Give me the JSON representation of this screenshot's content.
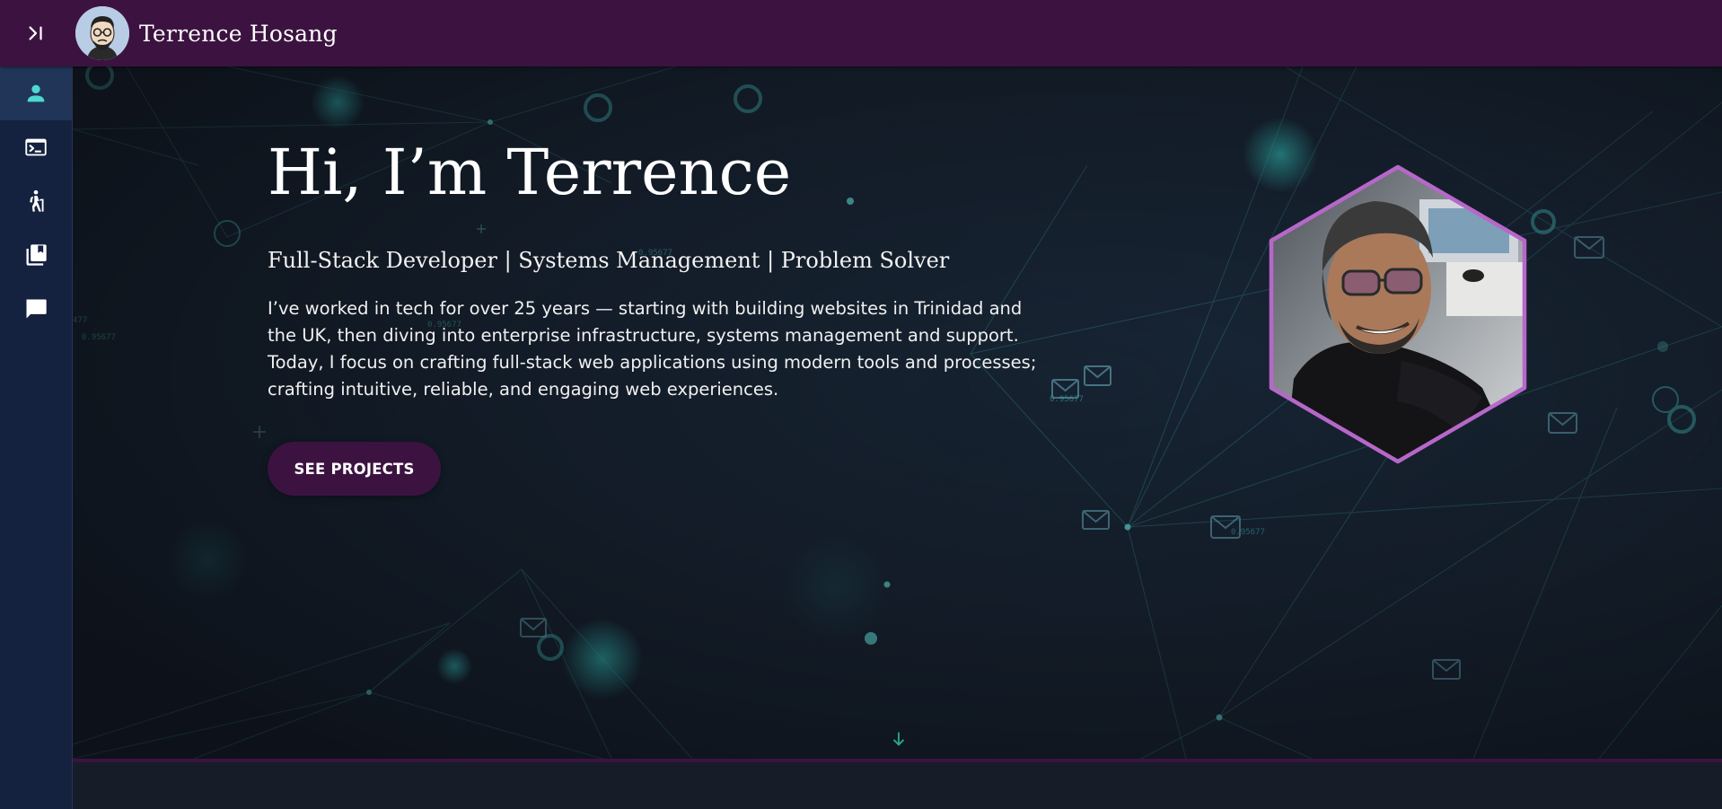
{
  "header": {
    "brand_name": "Terrence Hosang",
    "toggle_icon": "chevron-right-bar-icon",
    "avatar_icon": "cartoon-avatar-icon"
  },
  "sidebar": {
    "items": [
      {
        "icon": "person-icon",
        "active": true
      },
      {
        "icon": "terminal-icon",
        "active": false
      },
      {
        "icon": "hiking-icon",
        "active": false
      },
      {
        "icon": "library-books-icon",
        "active": false
      },
      {
        "icon": "chat-icon",
        "active": false
      }
    ]
  },
  "hero": {
    "title": "Hi, I’m Terrence",
    "subtitle": "Full-Stack Developer | Systems Management | Problem Solver",
    "intro": "I’ve worked in tech for over 25 years — starting with building websites in Trinidad and the UK, then diving into enterprise infrastructure, systems management and support. Today, I focus on crafting full-stack web applications using modern tools and processes; crafting intuitive, reliable, and engaging web experiences.",
    "cta_label": "SEE PROJECTS",
    "scroll_icon": "arrow-down-icon"
  },
  "colors": {
    "header_bg": "#3c1340",
    "sidebar_bg": "#14213f",
    "sidebar_active": "#213559",
    "accent_teal": "#4dd9d0",
    "portrait_border": "#b767c9",
    "page_bg": "#131a27"
  }
}
